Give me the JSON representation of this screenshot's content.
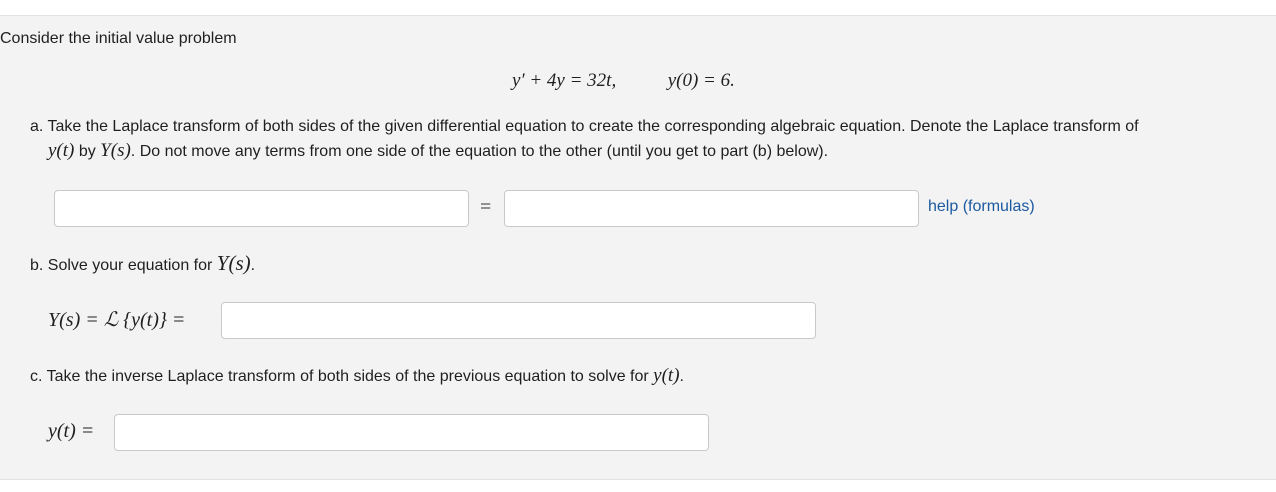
{
  "problem": {
    "intro": "Consider the initial value problem",
    "equation": {
      "lhs_y": "y",
      "lhs_prime": "′",
      "lhs_rest": " + 4y = 32t,",
      "ic": "y(0) = 6."
    }
  },
  "part_a": {
    "line1": "a. Take the Laplace transform of both sides of the given differential equation to create the corresponding algebraic equation. Denote the Laplace transform of",
    "line2_math1": "y(t)",
    "line2_by": " by ",
    "line2_math2": "Y(s)",
    "line2_rest": ". Do not move any terms from one side of the equation to the other (until you get to part (b) below).",
    "left_input": {
      "value": "",
      "placeholder": ""
    },
    "equals": "=",
    "right_input": {
      "value": "",
      "placeholder": ""
    },
    "help_link": "help (formulas)"
  },
  "part_b": {
    "text": "b. Solve your equation for ",
    "math": "Y(s)",
    "period": ".",
    "lhs_label": "Y(s) = ℒ {y(t)} =",
    "input": {
      "value": "",
      "placeholder": ""
    }
  },
  "part_c": {
    "text": "c. Take the inverse Laplace transform of both sides of the previous equation to solve for ",
    "math": "y(t)",
    "period": ".",
    "lhs_label": "y(t) =",
    "input": {
      "value": "",
      "placeholder": ""
    }
  },
  "colors": {
    "background": "#f3f3f3",
    "input_border": "#c9c9c9",
    "link": "#1b5aa0"
  }
}
